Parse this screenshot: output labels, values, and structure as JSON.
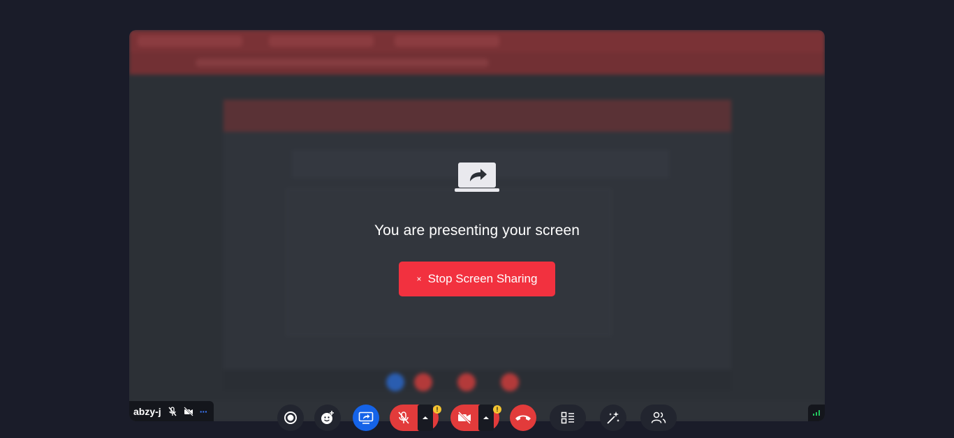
{
  "presenting": {
    "title": "You are presenting your screen",
    "stop_icon": "×",
    "stop_label": "Stop Screen Sharing"
  },
  "participant": {
    "name": "abzy-j",
    "more_icon": "···"
  },
  "colors": {
    "background": "#1a1c29",
    "stop_button": "#f2313f",
    "share_active": "#1563e8",
    "muted": "#e23b3b",
    "warning": "#f4c430"
  },
  "controls": {
    "mic_warning": "!",
    "camera_warning": "!"
  }
}
